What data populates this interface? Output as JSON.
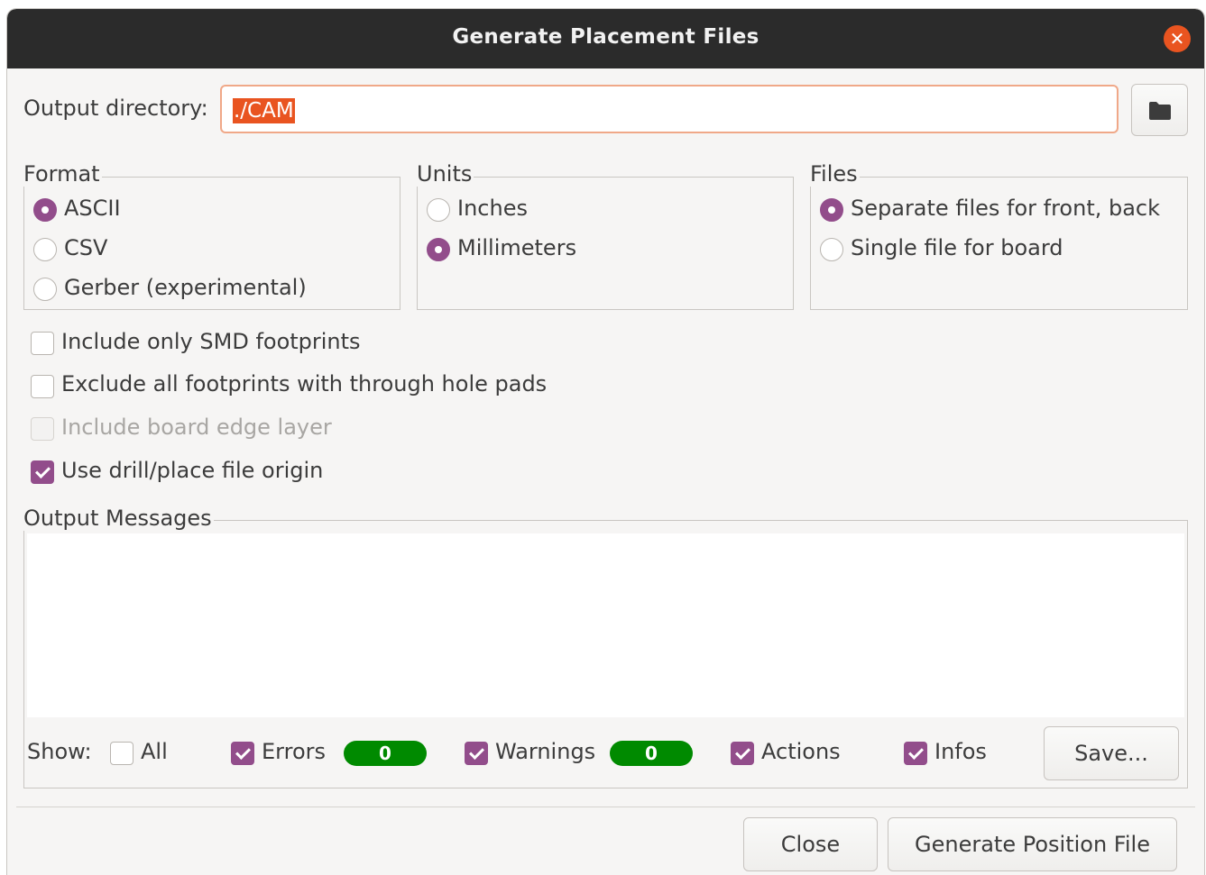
{
  "window": {
    "title": "Generate Placement Files",
    "close_glyph": "✕"
  },
  "output_directory": {
    "label": "Output directory:",
    "value": "./CAM",
    "browse_icon": "folder-icon"
  },
  "format": {
    "title": "Format",
    "options": [
      {
        "label": "ASCII",
        "selected": true
      },
      {
        "label": "CSV",
        "selected": false
      },
      {
        "label": "Gerber (experimental)",
        "selected": false
      }
    ]
  },
  "units": {
    "title": "Units",
    "options": [
      {
        "label": "Inches",
        "selected": false
      },
      {
        "label": "Millimeters",
        "selected": true
      }
    ]
  },
  "files": {
    "title": "Files",
    "options": [
      {
        "label": "Separate files for front, back",
        "selected": true
      },
      {
        "label": "Single file for board",
        "selected": false
      }
    ]
  },
  "options": [
    {
      "label": "Include only SMD footprints",
      "checked": false,
      "enabled": true
    },
    {
      "label": "Exclude all footprints with through hole pads",
      "checked": false,
      "enabled": true
    },
    {
      "label": "Include board edge layer",
      "checked": false,
      "enabled": false
    },
    {
      "label": "Use drill/place file origin",
      "checked": true,
      "enabled": true
    }
  ],
  "messages": {
    "title": "Output Messages",
    "show_label": "Show:",
    "filters": {
      "all": {
        "label": "All",
        "checked": false
      },
      "errors": {
        "label": "Errors",
        "checked": true,
        "count": "0"
      },
      "warnings": {
        "label": "Warnings",
        "checked": true,
        "count": "0"
      },
      "actions": {
        "label": "Actions",
        "checked": true
      },
      "infos": {
        "label": "Infos",
        "checked": true
      }
    },
    "save_label": "Save..."
  },
  "buttons": {
    "close_label": "Close",
    "generate_label": "Generate Position File"
  },
  "colors": {
    "accent": "#924d8b",
    "selection": "#e95420",
    "badge": "#008a00",
    "titlebar": "#2b2b2b"
  }
}
